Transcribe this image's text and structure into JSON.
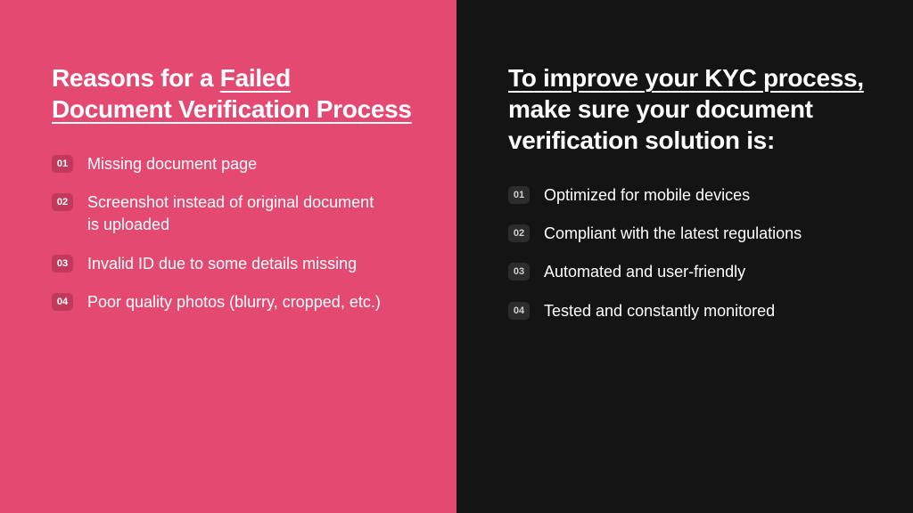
{
  "left": {
    "title_prefix": "Reasons for a ",
    "title_underlined": "Failed Document Verification Process",
    "items": [
      {
        "num": "01",
        "text": "Missing document page"
      },
      {
        "num": "02",
        "text": "Screenshot instead of original document is uploaded"
      },
      {
        "num": "03",
        "text": "Invalid ID due to some details missing"
      },
      {
        "num": "04",
        "text": "Poor quality photos (blurry, cropped, etc.)"
      }
    ]
  },
  "right": {
    "title_underlined": "To improve your KYC process,",
    "title_suffix": " make sure your document verification solution is:",
    "items": [
      {
        "num": "01",
        "text": "Optimized for mobile devices"
      },
      {
        "num": "02",
        "text": "Compliant with the latest regulations"
      },
      {
        "num": "03",
        "text": "Automated and user-friendly"
      },
      {
        "num": "04",
        "text": "Tested and constantly monitored"
      }
    ]
  }
}
